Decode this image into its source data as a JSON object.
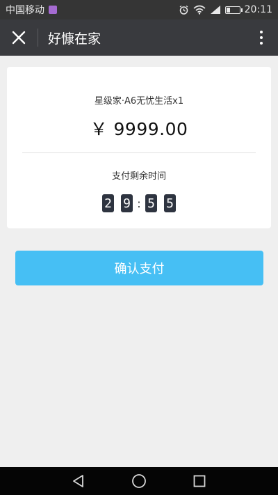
{
  "status_bar": {
    "carrier": "中国移动",
    "time": "20:11",
    "battery_level": 0.25
  },
  "header": {
    "title": "好慷在家"
  },
  "order": {
    "product_name": "星级家·A6无忧生活x1",
    "price": "￥ 9999.00"
  },
  "countdown": {
    "label": "支付剩余时间",
    "digits": [
      "2",
      "9",
      "5",
      "5"
    ],
    "separator": ":"
  },
  "actions": {
    "confirm_label": "确认支付"
  },
  "colors": {
    "accent": "#46bff4",
    "title_bar": "#393a3e",
    "digit_bg": "#2e3440"
  },
  "icons": {
    "close": "close-icon",
    "more": "more-vertical-icon",
    "back": "back-triangle-icon",
    "home": "home-circle-icon",
    "recents": "recents-square-icon",
    "alarm": "alarm-icon",
    "wifi": "wifi-icon",
    "signal": "signal-icon",
    "battery": "battery-icon"
  }
}
